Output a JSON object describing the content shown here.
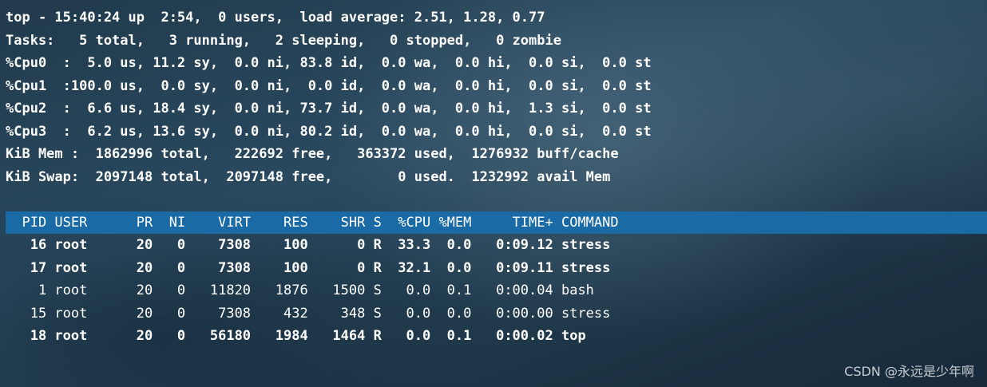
{
  "summary": {
    "line1": "top - 15:40:24 up  2:54,  0 users,  load average: 2.51, 1.28, 0.77",
    "line2": "Tasks:   5 total,   3 running,   2 sleeping,   0 stopped,   0 zombie",
    "line3": "%Cpu0  :  5.0 us, 11.2 sy,  0.0 ni, 83.8 id,  0.0 wa,  0.0 hi,  0.0 si,  0.0 st",
    "line4": "%Cpu1  :100.0 us,  0.0 sy,  0.0 ni,  0.0 id,  0.0 wa,  0.0 hi,  0.0 si,  0.0 st",
    "line5": "%Cpu2  :  6.6 us, 18.4 sy,  0.0 ni, 73.7 id,  0.0 wa,  0.0 hi,  1.3 si,  0.0 st",
    "line6": "%Cpu3  :  6.2 us, 13.6 sy,  0.0 ni, 80.2 id,  0.0 wa,  0.0 hi,  0.0 si,  0.0 st",
    "line7": "KiB Mem :  1862996 total,   222692 free,   363372 used,  1276932 buff/cache",
    "line8": "KiB Swap:  2097148 total,  2097148 free,        0 used.  1232992 avail Mem"
  },
  "process_table": {
    "header": "  PID USER      PR  NI    VIRT    RES    SHR S  %CPU %MEM     TIME+ COMMAND                                              ",
    "rows": [
      {
        "text": "   16 root      20   0    7308    100      0 R  33.3  0.0   0:09.12 stress",
        "bold": true
      },
      {
        "text": "   17 root      20   0    7308    100      0 R  32.1  0.0   0:09.11 stress",
        "bold": true
      },
      {
        "text": "    1 root      20   0   11820   1876   1500 S   0.0  0.1   0:00.04 bash",
        "bold": false
      },
      {
        "text": "   15 root      20   0    7308    432    348 S   0.0  0.0   0:00.00 stress",
        "bold": false
      },
      {
        "text": "   18 root      20   0   56180   1984   1464 R   0.0  0.1   0:00.02 top",
        "bold": true
      }
    ]
  },
  "watermark": "CSDN @永远是少年啊",
  "colors": {
    "header_highlight": "#1a6aa6",
    "text": "#ffffff"
  }
}
